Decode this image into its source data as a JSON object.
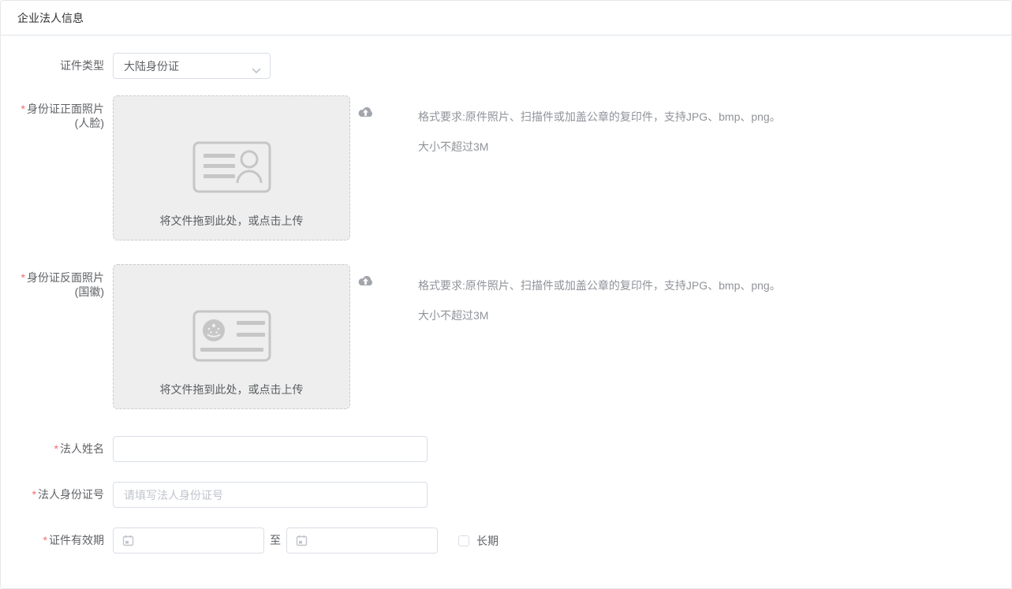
{
  "panel": {
    "title": "企业法人信息"
  },
  "cert_type": {
    "label": "证件类型",
    "value": "大陆身份证"
  },
  "front_photo": {
    "required_mark": "*",
    "label_line1": "身份证正面照片",
    "label_line2": "(人脸)",
    "dropzone_text": "将文件拖到此处，或点击上传",
    "tip_line1": "格式要求:原件照片、扫描件或加盖公章的复印件，支持JPG、bmp、png。",
    "tip_line2": "大小不超过3M"
  },
  "back_photo": {
    "required_mark": "*",
    "label_line1": "身份证反面照片",
    "label_line2": "(国徽)",
    "dropzone_text": "将文件拖到此处，或点击上传",
    "tip_line1": "格式要求:原件照片、扫描件或加盖公章的复印件，支持JPG、bmp、png。",
    "tip_line2": "大小不超过3M"
  },
  "legal_name": {
    "required_mark": "*",
    "label": "法人姓名",
    "value": ""
  },
  "legal_id": {
    "required_mark": "*",
    "label": "法人身份证号",
    "placeholder": "请填写法人身份证号"
  },
  "validity": {
    "required_mark": "*",
    "label": "证件有效期",
    "start_value": "",
    "to_text": "至",
    "end_value": "",
    "long_term_label": "长期",
    "long_term_checked": false
  },
  "colors": {
    "required_red": "#f56c6c",
    "input_border": "#d9dee6",
    "dropzone_bg": "#eeeeee",
    "tip_gray": "#909399",
    "icon_gray": "#c6c6c6"
  }
}
